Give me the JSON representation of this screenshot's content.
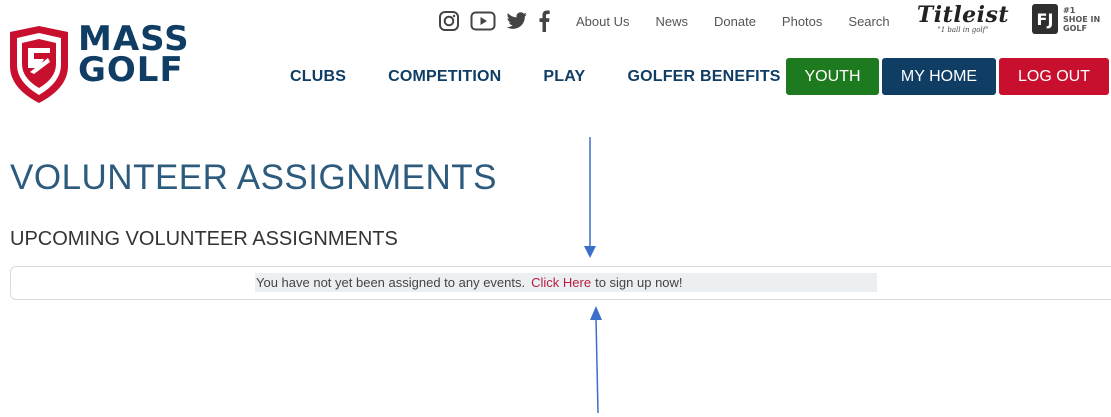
{
  "brand": {
    "line1": "MASS",
    "line2": "GOLF",
    "navy": "#0f3d63",
    "red": "#c8102e"
  },
  "social": {
    "icons": [
      "instagram-icon",
      "youtube-icon",
      "twitter-icon",
      "facebook-icon"
    ]
  },
  "utility_nav": {
    "about": "About Us",
    "news": "News",
    "donate": "Donate",
    "photos": "Photos",
    "search": "Search"
  },
  "sponsors": {
    "titleist": "Titleist",
    "titleist_tagline": "\"1 ball in golf\"",
    "fj": "FJ",
    "fj_tagline": "#1 SHOE IN GOLF"
  },
  "main_nav": {
    "clubs": "CLUBS",
    "competition": "COMPETITION",
    "play": "PLAY",
    "benefits": "GOLFER BENEFITS"
  },
  "buttons": {
    "youth": {
      "label": "YOUTH",
      "color": "#1e7a1e"
    },
    "my_home": {
      "label": "MY HOME",
      "color": "#0f3d63"
    },
    "logout": {
      "label": "LOG OUT",
      "color": "#c8102e"
    }
  },
  "page": {
    "title": "VOLUNTEER ASSIGNMENTS",
    "section_title": "UPCOMING VOLUNTEER ASSIGNMENTS",
    "notice_text": "You have not yet been assigned to any events.",
    "notice_link": "Click Here",
    "notice_suffix": "to sign up now!"
  },
  "annotation_color": "#3b6fc9"
}
